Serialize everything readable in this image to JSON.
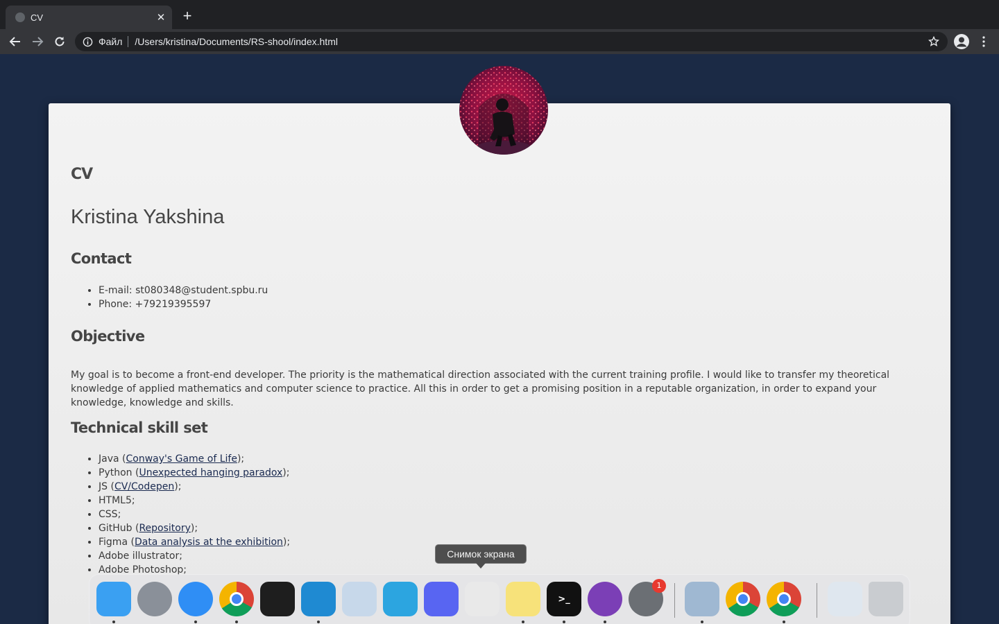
{
  "browser": {
    "tab_title": "CV",
    "new_tab_label": "+",
    "close_label": "✕",
    "scheme_label": "Файл",
    "url": "/Users/kristina/Documents/RS-shool/index.html"
  },
  "page": {
    "cv_heading": "CV",
    "name": "Kristina Yakshina",
    "contact_heading": "Contact",
    "contact": {
      "email_label": "E-mail:",
      "email": "st080348@student.spbu.ru",
      "phone_label": "Phone:",
      "phone": "+79219395597"
    },
    "objective_heading": "Objective",
    "objective_text": "My goal is to become a front-end developer. The priority is the mathematical direction associated with the current training profile. I would like to transfer my theoretical knowledge of applied mathematics and computer science to practice. All this in order to get a promising position in a reputable organization, in order to expand your knowledge, knowledge and skills.",
    "skills_heading": "Technical skill set",
    "skills": [
      {
        "name": "Java",
        "link": "Conway's Game of Life"
      },
      {
        "name": "Python",
        "link": "Unexpected hanging paradox"
      },
      {
        "name": "JS",
        "link": "CV/Codepen"
      },
      {
        "name": "HTML5",
        "link": ""
      },
      {
        "name": "CSS",
        "link": ""
      },
      {
        "name": "GitHub",
        "link": "Repository"
      },
      {
        "name": "Figma",
        "link": "Data analysis at the exhibition"
      },
      {
        "name": "Adobe illustrator",
        "link": ""
      },
      {
        "name": "Adobe Photoshop",
        "link": ""
      }
    ]
  },
  "dock": {
    "tooltip": "Снимок экрана",
    "items": [
      {
        "name": "finder-icon",
        "color": "#3aa0f2",
        "glyph": ""
      },
      {
        "name": "launchpad-icon",
        "color": "#8a9099",
        "glyph": ""
      },
      {
        "name": "safari-icon",
        "color": "#2f8ef5",
        "glyph": ""
      },
      {
        "name": "chrome-icon",
        "color": "#ffffff",
        "glyph": ""
      },
      {
        "name": "figma-icon",
        "color": "#1e1e1e",
        "glyph": ""
      },
      {
        "name": "vscode-icon",
        "color": "#1f8ad2",
        "glyph": ""
      },
      {
        "name": "preview-eagle-icon",
        "color": "#c7d8ea",
        "glyph": ""
      },
      {
        "name": "telegram-icon",
        "color": "#2ca5e0",
        "glyph": ""
      },
      {
        "name": "discord-icon",
        "color": "#5865f2",
        "glyph": ""
      },
      {
        "name": "screenshot-icon",
        "color": "#e9e9e9",
        "glyph": ""
      },
      {
        "name": "notes-icon",
        "color": "#f7e27a",
        "glyph": ""
      },
      {
        "name": "terminal-icon",
        "color": "#111111",
        "glyph": ">_"
      },
      {
        "name": "github-desktop-icon",
        "color": "#7b3fb6",
        "glyph": ""
      },
      {
        "name": "system-preferences-icon",
        "color": "#6b6f74",
        "glyph": "",
        "badge": "1"
      },
      {
        "name": "preview-icon",
        "color": "#9fb8d2",
        "glyph": ""
      },
      {
        "name": "chrome-icon-2",
        "color": "#ffffff",
        "glyph": ""
      },
      {
        "name": "chrome-icon-3",
        "color": "#ffffff",
        "glyph": ""
      },
      {
        "name": "downloads-stack-icon",
        "color": "#dfe7ef",
        "glyph": ""
      },
      {
        "name": "trash-icon",
        "color": "#c9ccd0",
        "glyph": ""
      }
    ]
  }
}
